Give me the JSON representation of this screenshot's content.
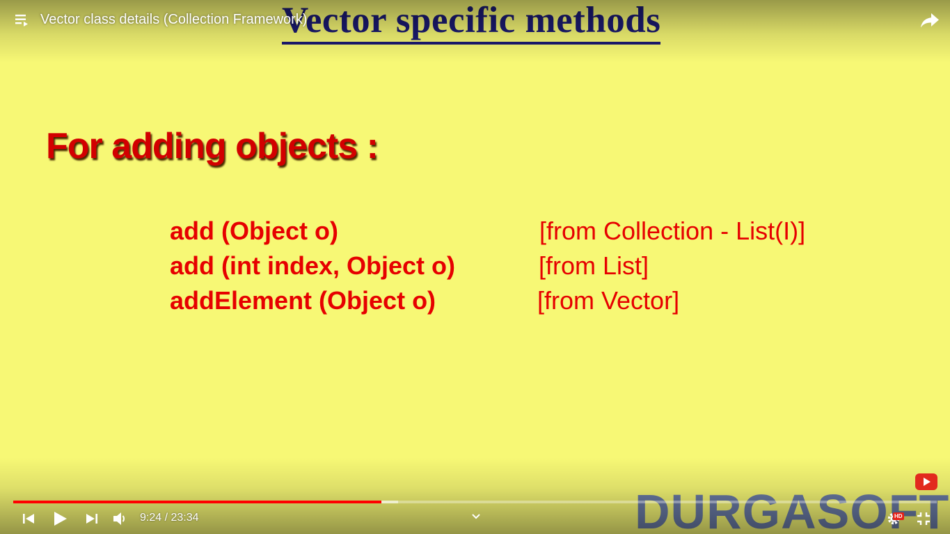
{
  "player": {
    "video_title": "Vector class details (Collection Framework)",
    "time_display": "9:24 / 23:34",
    "progress": {
      "played_fraction": 0.399,
      "buffered_fraction": 0.417
    },
    "hd_badge": "HD",
    "icons": {
      "playlist": "playlist-icon",
      "share": "share-icon",
      "previous": "previous-icon",
      "play": "play-icon",
      "next": "next-icon",
      "volume": "volume-icon",
      "chevron": "chevron-down-icon",
      "settings": "gear-icon",
      "exit_fullscreen": "exit-fullscreen-icon",
      "subscribe": "subscribe-icon"
    },
    "colors": {
      "progress_played": "#ff0000",
      "hd_badge": "#e62117"
    }
  },
  "slide": {
    "title": "Vector specific methods",
    "heading": "For adding objects :",
    "methods": [
      {
        "name": "add (Object o)",
        "source": "[from Collection  - List(I)]"
      },
      {
        "name": "add (int index, Object o)",
        "source": "[from List]"
      },
      {
        "name": "addElement (Object o)",
        "source": "[from Vector]"
      }
    ],
    "watermark": "DURGASOFT",
    "colors": {
      "background": "#f7f875",
      "title": "#1b1a72",
      "text": "#e60000",
      "heading": "#d20000"
    }
  }
}
